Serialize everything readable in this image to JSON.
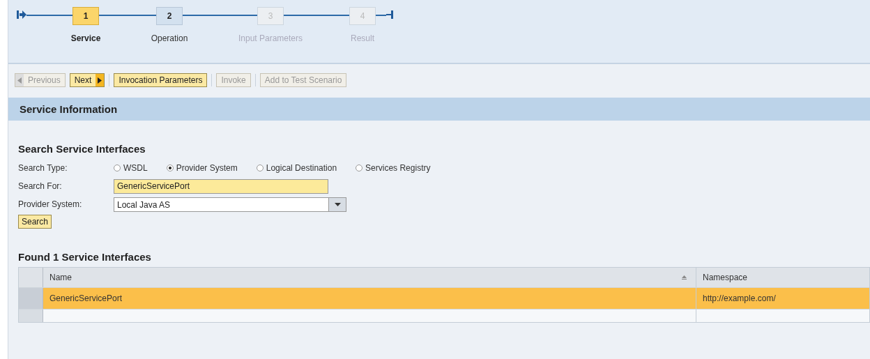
{
  "roadmap": {
    "steps": [
      {
        "number": "1",
        "label": "Service",
        "selected": true,
        "disabled": false
      },
      {
        "number": "2",
        "label": "Operation",
        "selected": false,
        "disabled": false
      },
      {
        "number": "3",
        "label": "Input Parameters",
        "selected": false,
        "disabled": true
      },
      {
        "number": "4",
        "label": "Result",
        "selected": false,
        "disabled": true
      }
    ]
  },
  "toolbar": [
    {
      "label": "Previous",
      "kind": "prev",
      "disabled": true
    },
    {
      "label": "Next",
      "kind": "next",
      "disabled": false
    },
    {
      "label": "Invocation Parameters",
      "kind": "plain",
      "disabled": false
    },
    {
      "label": "Invoke",
      "kind": "plain",
      "disabled": true
    },
    {
      "label": "Add to Test Scenario",
      "kind": "plain",
      "disabled": true
    }
  ],
  "section": {
    "title": "Service Information"
  },
  "search": {
    "title": "Search Service Interfaces",
    "type_label": "Search Type:",
    "types": [
      {
        "label": "WSDL",
        "selected": false
      },
      {
        "label": "Provider System",
        "selected": true
      },
      {
        "label": "Logical Destination",
        "selected": false
      },
      {
        "label": "Services Registry",
        "selected": false
      }
    ],
    "for_label": "Search For:",
    "for_value": "GenericServicePort",
    "system_label": "Provider System:",
    "system_value": "Local Java AS",
    "button": "Search"
  },
  "results": {
    "title": "Found 1 Service Interfaces",
    "columns": [
      {
        "label": "Name",
        "sorted": true
      },
      {
        "label": "Namespace",
        "sorted": false
      }
    ],
    "rows": [
      {
        "cells": [
          "GenericServicePort",
          "http://example.com/"
        ],
        "selected": true
      }
    ]
  }
}
